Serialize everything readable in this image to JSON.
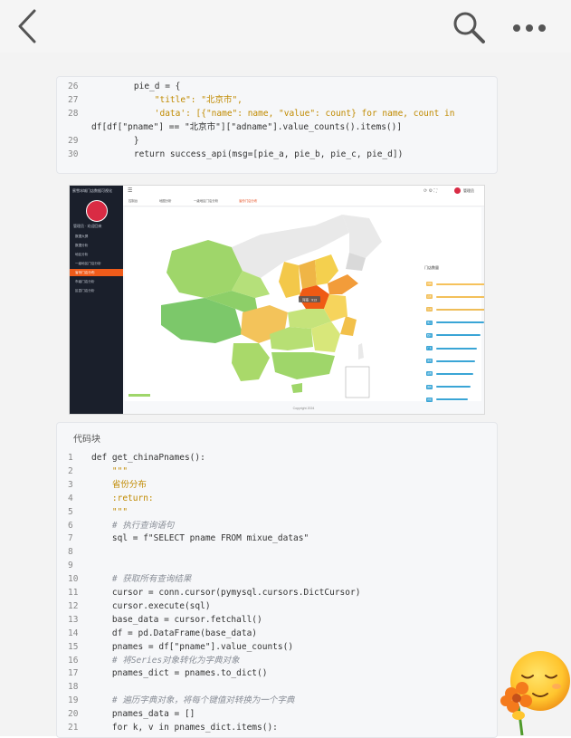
{
  "code_block_1": {
    "lines": [
      {
        "n": "26",
        "t": "    pie_d = {"
      },
      {
        "n": "27",
        "t": "        \"title\": \"北京市\","
      },
      {
        "n": "28",
        "t": "        'data': [{\"name\": name, \"value\": count} for name, count in"
      },
      {
        "n": "",
        "t": "df[df[\"pname\"] == \"北京市\"][\"adname\"].value_counts().items()]"
      },
      {
        "n": "29",
        "t": "    }"
      },
      {
        "n": "30",
        "t": "    return success_api(msg=[pie_a, pie_b, pie_c, pie_d])"
      }
    ]
  },
  "screenshot": {
    "sidebar": {
      "app_title": "蜜雪冰城门店数据可视化",
      "user": "管理员 · 欢迎回来",
      "items": [
        {
          "label": "数据大屏",
          "active": false
        },
        {
          "label": "数据分析",
          "active": false
        },
        {
          "label": "地区分析",
          "active": false
        },
        {
          "label": "一级地区门店分析",
          "active": false
        },
        {
          "label": "省份门店分布",
          "active": true
        },
        {
          "label": "市级门店分析",
          "active": false
        },
        {
          "label": "区县门店分析",
          "active": false
        }
      ]
    },
    "tabs": [
      {
        "label": "控制台",
        "active": false
      },
      {
        "label": "地图分析",
        "active": false
      },
      {
        "label": "一级地区门店分析",
        "active": false
      },
      {
        "label": "省份门店分布",
        "active": true
      }
    ],
    "user_name": "管理员",
    "map_tooltip": "河南 : 913",
    "chart_title": "门店数量",
    "bar_labels": [
      "河南",
      "山东",
      "江苏",
      "浙江",
      "四川",
      "广东",
      "湖北",
      "安徽",
      "湖南",
      "河北"
    ],
    "bar_values": [
      913,
      780,
      720,
      650,
      600,
      560,
      530,
      500,
      470,
      430
    ],
    "bar_colors": [
      "#f6c25c",
      "#f3c05a",
      "#efbd58",
      "#3aa5d6",
      "#3aa5d6",
      "#3aa5d6",
      "#3aa5d6",
      "#3aa5d6",
      "#3aa5d6",
      "#3aa5d6"
    ],
    "footer": "Copyright 2024"
  },
  "code_block_2": {
    "label": "代码块",
    "lines": [
      {
        "n": "1",
        "t": "def get_chinaPnames():"
      },
      {
        "n": "2",
        "t": "    \"\"\""
      },
      {
        "n": "3",
        "t": "    省份分布"
      },
      {
        "n": "4",
        "t": "    :return:"
      },
      {
        "n": "5",
        "t": "    \"\"\""
      },
      {
        "n": "6",
        "t": "    # 执行查询语句"
      },
      {
        "n": "7",
        "t": "    sql = f\"SELECT pname FROM mixue_datas\""
      },
      {
        "n": "8",
        "t": ""
      },
      {
        "n": "9",
        "t": ""
      },
      {
        "n": "10",
        "t": "    # 获取所有查询结果"
      },
      {
        "n": "11",
        "t": "    cursor = conn.cursor(pymysql.cursors.DictCursor)"
      },
      {
        "n": "12",
        "t": "    cursor.execute(sql)"
      },
      {
        "n": "13",
        "t": "    base_data = cursor.fetchall()"
      },
      {
        "n": "14",
        "t": "    df = pd.DataFrame(base_data)"
      },
      {
        "n": "15",
        "t": "    pnames = df[\"pname\"].value_counts()"
      },
      {
        "n": "16",
        "t": "    # 将Series对象转化为字典对象"
      },
      {
        "n": "17",
        "t": "    pnames_dict = pnames.to_dict()"
      },
      {
        "n": "18",
        "t": ""
      },
      {
        "n": "19",
        "t": "    # 遍历字典对象，将每个键值对转换为一个字典"
      },
      {
        "n": "20",
        "t": "    pnames_data = []"
      },
      {
        "n": "21",
        "t": "    for k, v in pnames_dict.items():"
      }
    ]
  },
  "icons": {
    "back": "chevron-left-icon",
    "search": "search-icon",
    "more": "more-dots-icon",
    "emoji": "relieved-face-with-flower-icon"
  },
  "colors": {
    "accent": "#ef5b1a",
    "sidebar": "#1a1f2b",
    "code_bg": "#f6f7f9"
  }
}
